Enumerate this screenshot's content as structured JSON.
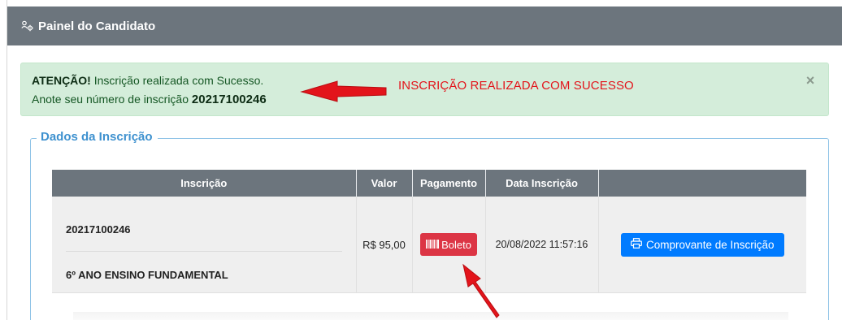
{
  "header": {
    "title": "Painel do Candidato",
    "icon": "users-gear-icon"
  },
  "alert": {
    "attention": "ATENÇÃO!",
    "message": "Inscrição realizada com Sucesso.",
    "note_prefix": "Anote seu número de inscrição",
    "registration_number": "20217100246",
    "close_label": "×",
    "color_bg": "#d4edda",
    "color_text": "#155724"
  },
  "annotation": {
    "text": "INSCRIÇÃO REALIZADA COM SUCESSO",
    "color": "#e3141b"
  },
  "section": {
    "legend": "Dados da Inscrição"
  },
  "table": {
    "headers": [
      "Inscrição",
      "Valor",
      "Pagamento",
      "Data Inscrição",
      ""
    ],
    "row": {
      "number": "20217100246",
      "course": "6º ANO ENSINO FUNDAMENTAL",
      "value": "R$ 95,00",
      "payment_label": "Boleto",
      "payment_icon": "barcode-icon",
      "date": "20/08/2022 11:57:16",
      "action_label": "Comprovante de Inscrição",
      "action_icon": "printer-icon"
    }
  },
  "colors": {
    "header_bg": "#6c757d",
    "danger": "#dc3545",
    "primary": "#007bff",
    "legend": "#3e91cf"
  }
}
